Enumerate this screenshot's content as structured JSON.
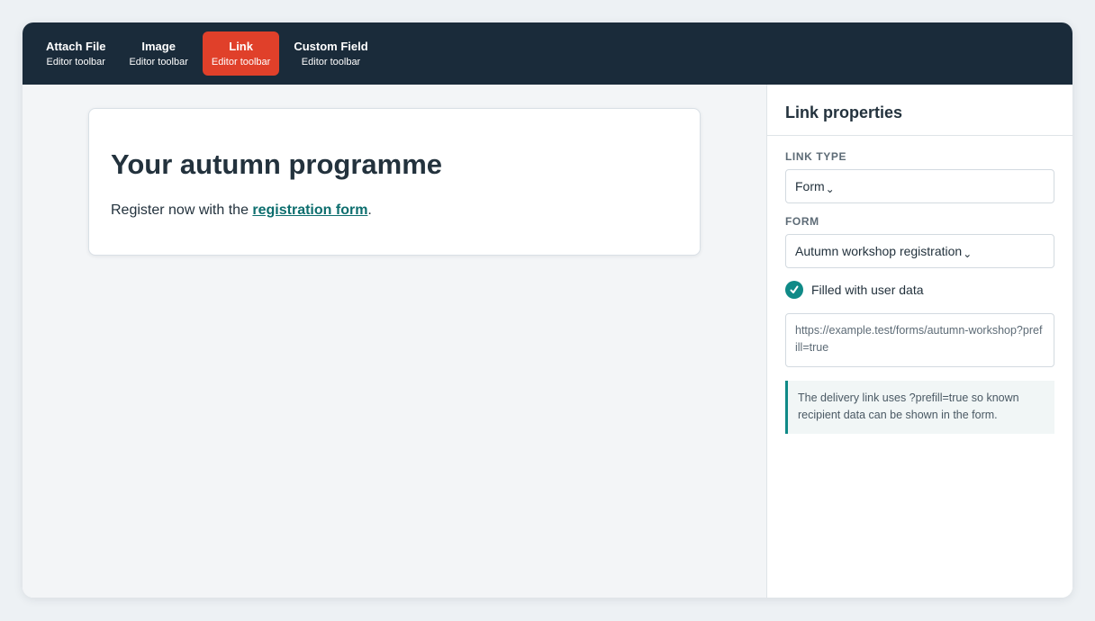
{
  "toolbar": {
    "items": [
      {
        "title": "Attach File",
        "subtitle": "Editor toolbar",
        "active": false
      },
      {
        "title": "Image",
        "subtitle": "Editor toolbar",
        "active": false
      },
      {
        "title": "Link",
        "subtitle": "Editor toolbar",
        "active": true
      },
      {
        "title": "Custom Field",
        "subtitle": "Editor toolbar",
        "active": false
      }
    ]
  },
  "document": {
    "heading": "Your autumn programme",
    "text_before": "Register now with the ",
    "link_text": "registration form",
    "text_after": "."
  },
  "panel": {
    "title": "Link properties",
    "link_type_label": "LINK TYPE",
    "link_type_value": "Form",
    "form_label": "FORM",
    "form_value": "Autumn workshop registration",
    "checkbox_label": "Filled with user data",
    "checkbox_checked": true,
    "url": "https://example.test/forms/autumn-workshop?prefill=true",
    "note": "The delivery link uses ?prefill=true so known recipient data can be shown in the form."
  },
  "icons": {
    "dropdown": "chevron-down-icon",
    "checkbox": "check-icon"
  },
  "colors": {
    "toolbar_bg": "#1a2b3a",
    "active_tool": "#e0402a",
    "accent_teal": "#0f8a87",
    "link": "#0d6e6e"
  }
}
